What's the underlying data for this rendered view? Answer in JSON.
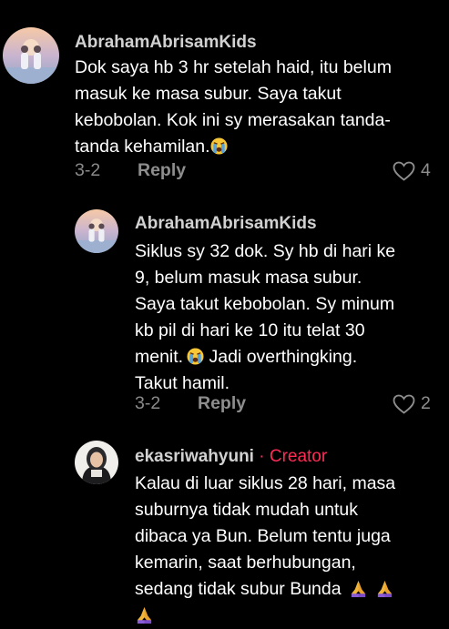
{
  "comments": [
    {
      "username": "AbrahamAbrisamKids",
      "lines": [
        "Dok saya hb 3 hr setelah haid, itu belum",
        "masuk ke masa subur. Saya takut",
        "kebobolan. Kok ini sy merasakan tanda-",
        "tanda kehamilan."
      ],
      "date": "3-2",
      "reply_label": "Reply",
      "likes": "4",
      "avatar_icon": "couple-photo-avatar"
    },
    {
      "username": "AbrahamAbrisamKids",
      "lines": [
        "Siklus sy 32 dok. Sy hb di hari ke",
        "9, belum masuk masa subur.",
        "Saya takut kebobolan. Sy minum",
        "kb pil di hari ke 10 itu telat 30",
        "menit.",
        " Jadi overthingking.",
        "Takut hamil."
      ],
      "date": "3-2",
      "reply_label": "Reply",
      "likes": "2",
      "avatar_icon": "couple-photo-avatar"
    },
    {
      "username": "ekasriwahyuni",
      "creator_separator": "·",
      "creator_label": "Creator",
      "lines": [
        "Kalau di luar siklus 28 hari, masa",
        "suburnya tidak mudah untuk",
        "dibaca ya Bun. Belum tentu juga",
        "kemarin, saat berhubungan,",
        "sedang tidak subur Bunda"
      ],
      "avatar_icon": "hijab-woman-avatar"
    }
  ],
  "colors": {
    "background": "#000000",
    "text": "#ffffff",
    "muted": "#8e8e8e",
    "creator": "#fe2c55"
  }
}
